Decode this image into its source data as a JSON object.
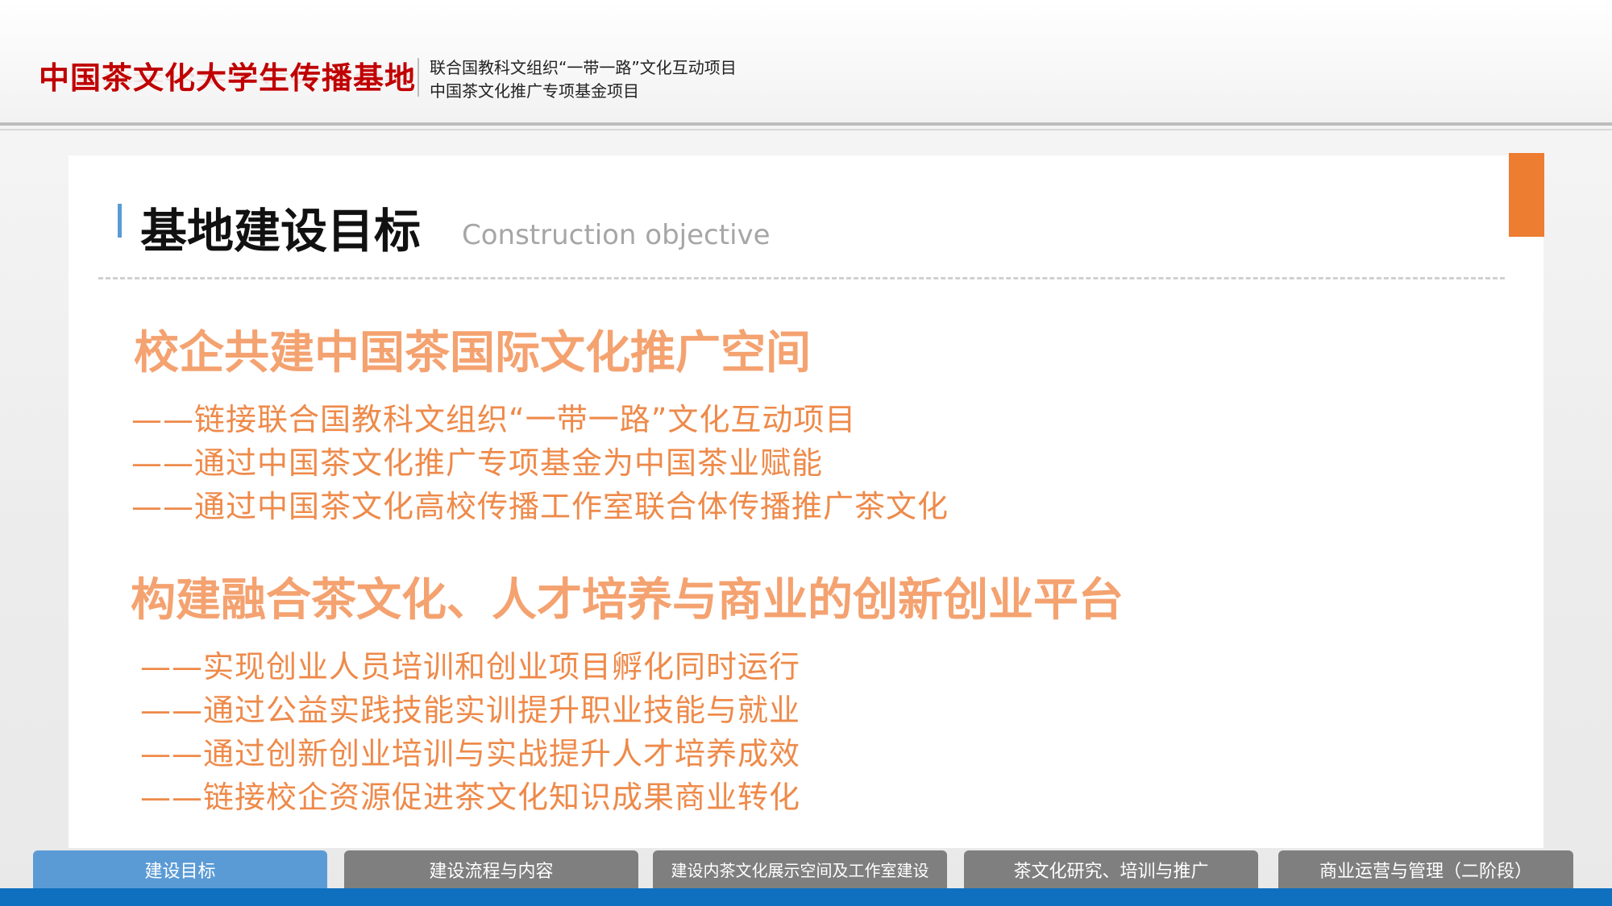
{
  "header": {
    "brand": "中国茶文化大学生传播基地",
    "subtitle_line1": "联合国教科文组织“一带一路”文化互动项目",
    "subtitle_line2": "中国茶文化推广专项基金项目"
  },
  "page": {
    "title": "基地建设目标",
    "title_en": "Construction objective"
  },
  "section1": {
    "heading": "校企共建中国茶国际文化推广空间",
    "items": [
      "——链接联合国教科文组织“一带一路”文化互动项目",
      "——通过中国茶文化推广专项基金为中国茶业赋能",
      "——通过中国茶文化高校传播工作室联合体传播推广茶文化"
    ]
  },
  "section2": {
    "heading": "构建融合茶文化、人才培养与商业的创新创业平台",
    "items": [
      "——实现创业人员培训和创业项目孵化同时运行",
      "——通过公益实践技能实训提升职业技能与就业",
      "——通过创新创业培训与实战提升人才培养成效",
      "——链接校企资源促进茶文化知识成果商业转化"
    ]
  },
  "tabs": [
    {
      "label": "建设目标",
      "active": true
    },
    {
      "label": "建设流程与内容",
      "active": false
    },
    {
      "label": "建设内茶文化展示空间及工作室建设",
      "active": false
    },
    {
      "label": "茶文化研究、培训与推广",
      "active": false
    },
    {
      "label": "商业运营与管理（二阶段）",
      "active": false
    }
  ],
  "colors": {
    "brand_red": "#c00000",
    "accent_orange": "#ed7d31",
    "heading_orange": "#f4a270",
    "item_orange": "#ee8a4a",
    "active_tab": "#5b9bd5",
    "inactive_tab": "#7f7f7f",
    "bottom_bar": "#0f70c0"
  }
}
